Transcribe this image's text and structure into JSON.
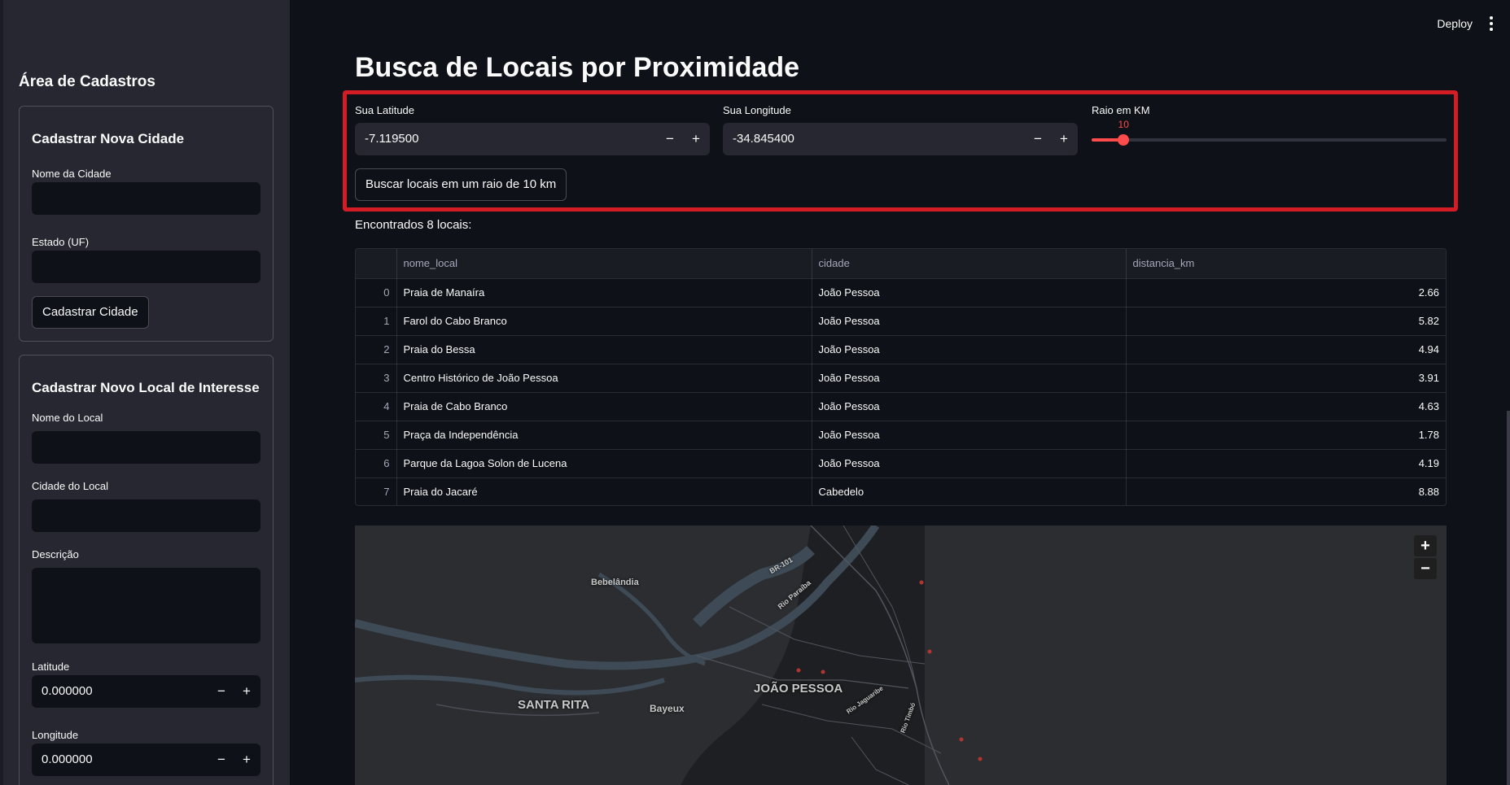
{
  "header": {
    "deploy_label": "Deploy",
    "menu_icon": "kebab-menu-icon"
  },
  "sidebar": {
    "title": "Área de Cadastros",
    "city_form": {
      "title": "Cadastrar Nova Cidade",
      "name_label": "Nome da Cidade",
      "name_value": "",
      "state_label": "Estado (UF)",
      "state_value": "",
      "submit_label": "Cadastrar Cidade"
    },
    "place_form": {
      "title": "Cadastrar Novo Local de Interesse",
      "name_label": "Nome do Local",
      "name_value": "",
      "city_label": "Cidade do Local",
      "city_value": "",
      "description_label": "Descrição",
      "description_value": "",
      "lat_label": "Latitude",
      "lat_value": "0.000000",
      "lon_label": "Longitude",
      "lon_value": "0.000000"
    }
  },
  "main": {
    "title": "Busca de Locais por Proximidade",
    "lat_label": "Sua Latitude",
    "lat_value": "-7.119500",
    "lon_label": "Sua Longitude",
    "lon_value": "-34.845400",
    "radius_label": "Raio em KM",
    "radius_value": "10",
    "radius_fraction": 0.09,
    "search_button": "Buscar locais em um raio de 10 km",
    "result_text": "Encontrados 8 locais:",
    "highlight_color": "#d41c24",
    "accent_color": "#ff4b4b"
  },
  "table": {
    "columns": [
      "",
      "nome_local",
      "cidade",
      "distancia_km"
    ],
    "rows": [
      {
        "idx": "0",
        "nome_local": "Praia de Manaíra",
        "cidade": "João Pessoa",
        "distancia_km": "2.66"
      },
      {
        "idx": "1",
        "nome_local": "Farol do Cabo Branco",
        "cidade": "João Pessoa",
        "distancia_km": "5.82"
      },
      {
        "idx": "2",
        "nome_local": "Praia do Bessa",
        "cidade": "João Pessoa",
        "distancia_km": "4.94"
      },
      {
        "idx": "3",
        "nome_local": "Centro Histórico de João Pessoa",
        "cidade": "João Pessoa",
        "distancia_km": "3.91"
      },
      {
        "idx": "4",
        "nome_local": "Praia de Cabo Branco",
        "cidade": "João Pessoa",
        "distancia_km": "4.63"
      },
      {
        "idx": "5",
        "nome_local": "Praça da Independência",
        "cidade": "João Pessoa",
        "distancia_km": "1.78"
      },
      {
        "idx": "6",
        "nome_local": "Parque da Lagoa Solon de Lucena",
        "cidade": "João Pessoa",
        "distancia_km": "4.19"
      },
      {
        "idx": "7",
        "nome_local": "Praia do Jacaré",
        "cidade": "Cabedelo",
        "distancia_km": "8.88"
      }
    ]
  },
  "map": {
    "labels": {
      "bebelandia": "Bebelândia",
      "santa_rita": "SANTA RITA",
      "bayeux": "Bayeux",
      "joao_pessoa": "JOÃO PESSOA",
      "br101": "BR-101",
      "rio_paraiba": "Rio Paraíba",
      "rio_jaguaribe": "Rio Jaguaribe",
      "rio_timbo": "Rio Timbó"
    },
    "zoom_in": "+",
    "zoom_out": "−"
  }
}
